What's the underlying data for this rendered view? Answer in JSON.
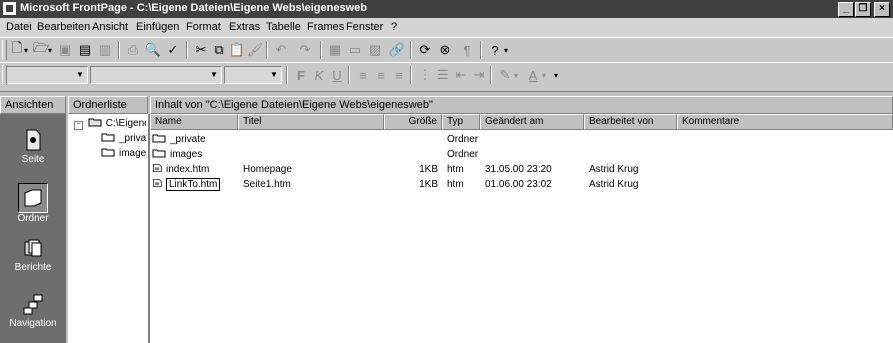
{
  "titlebar": {
    "title": "Microsoft FrontPage - C:\\Eigene Dateien\\Eigene Webs\\eigenesweb",
    "minimize": "_",
    "restore": "❐",
    "close": "×"
  },
  "menu": [
    "Datei",
    "Bearbeiten",
    "Ansicht",
    "Einfügen",
    "Format",
    "Extras",
    "Tabelle",
    "Frames",
    "Fenster",
    "?"
  ],
  "format_toolbar": {
    "bold": "F",
    "italic": "K",
    "underline": "U"
  },
  "views_pane": {
    "header": "Ansichten",
    "items": [
      {
        "label": "Seite",
        "icon": "page-view-icon"
      },
      {
        "label": "Ordner",
        "icon": "folder-view-icon",
        "active": true
      },
      {
        "label": "Berichte",
        "icon": "reports-view-icon"
      },
      {
        "label": "Navigation",
        "icon": "navigation-view-icon"
      }
    ]
  },
  "folder_pane": {
    "header": "Ordnerliste",
    "root": "C:\\Eigene",
    "children": [
      "_privat",
      "images"
    ]
  },
  "contents": {
    "header": "Inhalt von \"C:\\Eigene Dateien\\Eigene Webs\\eigenesweb\"",
    "columns": [
      "Name",
      "Titel",
      "Größe",
      "Typ",
      "Geändert am",
      "Bearbeitet von",
      "Kommentare"
    ],
    "rows": [
      {
        "name": "_private",
        "title": "",
        "size": "",
        "type": "Ordner",
        "modified": "",
        "by": "",
        "comments": "",
        "icon": "folder-icon"
      },
      {
        "name": "images",
        "title": "",
        "size": "",
        "type": "Ordner",
        "modified": "",
        "by": "",
        "comments": "",
        "icon": "folder-icon"
      },
      {
        "name": "index.htm",
        "title": "Homepage",
        "size": "1KB",
        "type": "htm",
        "modified": "31.05.00 23:20",
        "by": "Astrid Krug",
        "comments": "",
        "icon": "html-file-icon"
      },
      {
        "name": "LinkTo.htm",
        "title": "Seite1.htm",
        "size": "1KB",
        "type": "htm",
        "modified": "01.06.00 23:02",
        "by": "Astrid Krug",
        "comments": "",
        "icon": "html-file-icon",
        "editing": true
      }
    ]
  }
}
